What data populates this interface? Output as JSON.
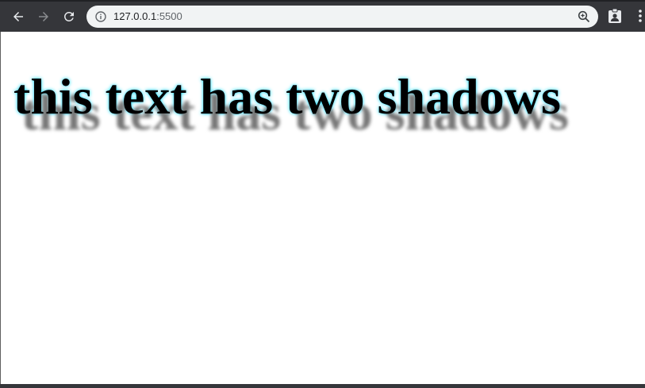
{
  "browser": {
    "url_host": "127.0.0.1",
    "url_port": ":5500",
    "icons": {
      "back": "arrow-left-icon",
      "forward": "arrow-right-icon",
      "reload": "reload-icon",
      "site_info": "info-icon",
      "zoom": "zoom-in-icon",
      "extension": "clipboard-person-icon",
      "menu": "kebab-menu-icon"
    },
    "colors": {
      "toolbar": "#35363a",
      "omnibox": "#f1f3f4"
    }
  },
  "page": {
    "heading": "this text has two shadows",
    "colors": {
      "text": "#000000",
      "shadow_gray": "#777777",
      "glow_cyan": "#00d8ff"
    }
  }
}
